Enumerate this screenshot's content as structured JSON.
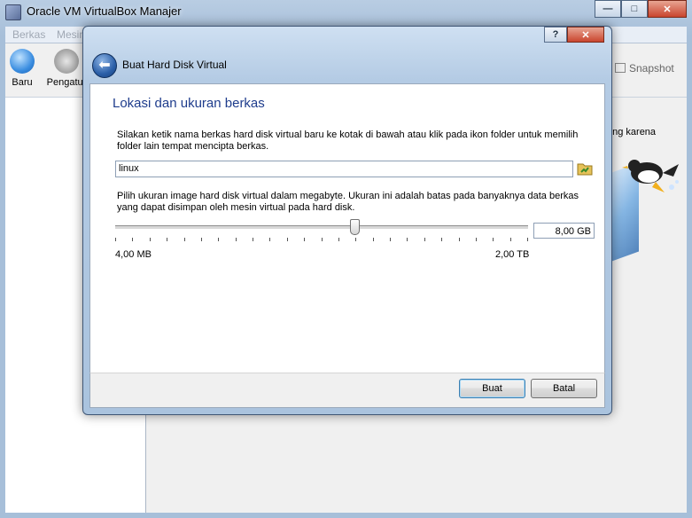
{
  "window": {
    "title": "Oracle VM VirtualBox Manajer"
  },
  "caption_buttons": {
    "minimize": "—",
    "maximize": "□",
    "close": "✕"
  },
  "menubar": {
    "items": [
      "Berkas",
      "Mesin"
    ]
  },
  "toolbar": {
    "new_label": "Baru",
    "settings_label": "Pengatur",
    "snapshot_label": "Snapshot"
  },
  "background": {
    "partial_text": "ong karena"
  },
  "dialog": {
    "caption": {
      "help": "?",
      "close": "✕"
    },
    "title": "Buat Hard Disk Virtual",
    "back_symbol": "⬅",
    "page_title": "Lokasi dan ukuran berkas",
    "location_desc": "Silakan ketik nama berkas hard disk virtual baru ke kotak di bawah atau klik pada ikon folder untuk memilih folder lain tempat mencipta berkas.",
    "location_value": "linux",
    "size_desc": "Pilih ukuran image hard disk virtual dalam megabyte. Ukuran ini adalah batas pada banyaknya data berkas yang dapat disimpan oleh mesin virtual pada hard disk.",
    "size_value": "8,00 GB",
    "slider_position_fraction": 0.58,
    "range_min": "4,00 MB",
    "range_max": "2,00 TB",
    "buttons": {
      "create": "Buat",
      "cancel": "Batal"
    }
  },
  "colors": {
    "page_title": "#1e3c8c",
    "accent": "#2b5fa8"
  }
}
